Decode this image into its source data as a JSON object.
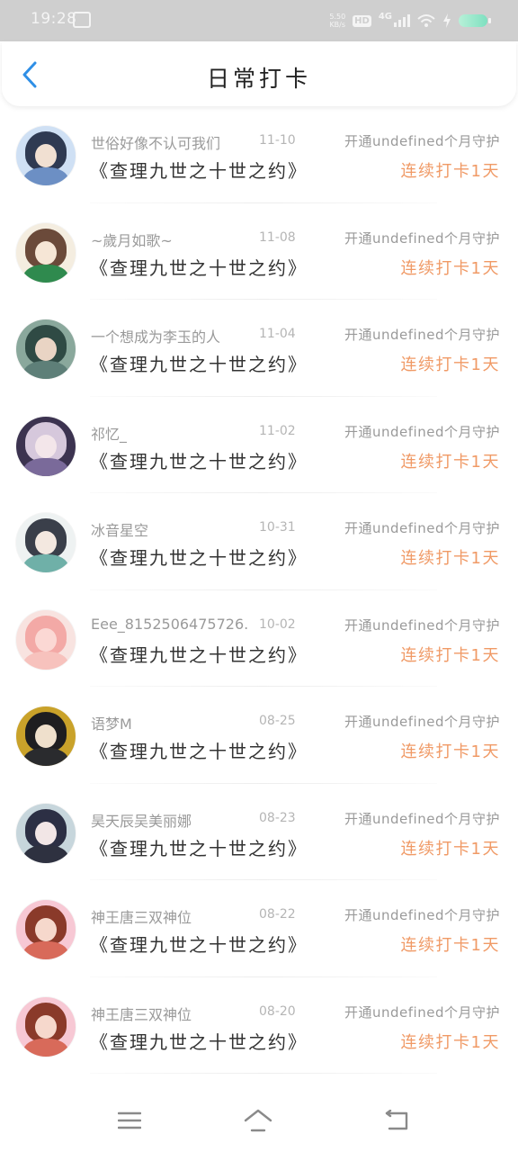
{
  "status_bar": {
    "time": "19:28",
    "net_speed_value": "5.50",
    "net_speed_unit": "KB/s",
    "hd_label": "HD",
    "network_label": "4G"
  },
  "header": {
    "title": "日常打卡",
    "back_icon": "chevron-left-icon"
  },
  "colors": {
    "accent_blue": "#2f8fe6",
    "streak_orange": "#f09a66"
  },
  "checkins": [
    {
      "name": "世俗好像不认可我们",
      "date": "11-10",
      "vip_note": "开通undefined个月守护",
      "book": "《查理九世之十世之约》",
      "streak": "连续打卡1天",
      "avatar_colors": [
        "#2f3a52",
        "#f1e0d2",
        "#6c8fc4",
        "#cfe0f4"
      ]
    },
    {
      "name": "~歲月如歌~",
      "date": "11-08",
      "vip_note": "开通undefined个月守护",
      "book": "《查理九世之十世之约》",
      "streak": "连续打卡1天",
      "avatar_colors": [
        "#6b4a3a",
        "#f6e6d6",
        "#2f8a4e",
        "#f4ede0"
      ]
    },
    {
      "name": "一个想成为李玉的人",
      "date": "11-04",
      "vip_note": "开通undefined个月守护",
      "book": "《查理九世之十世之约》",
      "streak": "连续打卡1天",
      "avatar_colors": [
        "#2f4a44",
        "#e9d4c4",
        "#5e7f78",
        "#8aa89c"
      ]
    },
    {
      "name": "祁忆_",
      "date": "11-02",
      "vip_note": "开通undefined个月守护",
      "book": "《查理九世之十世之约》",
      "streak": "连续打卡1天",
      "avatar_colors": [
        "#d6c8dc",
        "#f3e6ea",
        "#7a6a9a",
        "#3c3350"
      ]
    },
    {
      "name": "冰音星空",
      "date": "10-31",
      "vip_note": "开通undefined个月守护",
      "book": "《查理九世之十世之约》",
      "streak": "连续打卡1天",
      "avatar_colors": [
        "#3a3f4a",
        "#f3e8e0",
        "#6fb0a8",
        "#eef2f2"
      ]
    },
    {
      "name": "Eee_8152506475726...",
      "date": "10-02",
      "vip_note": "开通undefined个月守护",
      "book": "《查理九世之十世之约》",
      "streak": "连续打卡1天",
      "avatar_colors": [
        "#f3a9a6",
        "#fbd8d4",
        "#f7c2bd",
        "#f8e3e0"
      ]
    },
    {
      "name": "语梦M",
      "date": "08-25",
      "vip_note": "开通undefined个月守护",
      "book": "《查理九世之十世之约》",
      "streak": "连续打卡1天",
      "avatar_colors": [
        "#1e1e20",
        "#efe0cc",
        "#2a2b2e",
        "#c9a22a"
      ]
    },
    {
      "name": "昊天辰吴美丽娜",
      "date": "08-23",
      "vip_note": "开通undefined个月守护",
      "book": "《查理九世之十世之约》",
      "streak": "连续打卡1天",
      "avatar_colors": [
        "#2c2f44",
        "#f2e6e6",
        "#2e3140",
        "#c7d6dc"
      ]
    },
    {
      "name": "神王唐三双神位",
      "date": "08-22",
      "vip_note": "开通undefined个月守护",
      "book": "《查理九世之十世之约》",
      "streak": "连续打卡1天",
      "avatar_colors": [
        "#8a3a2a",
        "#f6d8cc",
        "#d86a5a",
        "#f7c8d4"
      ]
    },
    {
      "name": "神王唐三双神位",
      "date": "08-20",
      "vip_note": "开通undefined个月守护",
      "book": "《查理九世之十世之约》",
      "streak": "连续打卡1天",
      "avatar_colors": [
        "#8a3a2a",
        "#f6d8cc",
        "#d86a5a",
        "#f7c8d4"
      ]
    }
  ],
  "system_nav": {
    "menu_icon": "menu-icon",
    "home_icon": "home-icon",
    "back_icon": "back-arrow-icon"
  }
}
